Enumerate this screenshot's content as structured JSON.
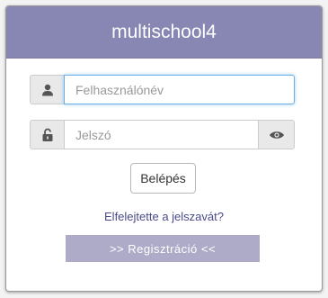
{
  "header": {
    "title": "multischool4"
  },
  "login": {
    "username_placeholder": "Felhasználónév",
    "username_value": "",
    "password_placeholder": "Jelszó",
    "password_value": "",
    "submit_label": "Belépés",
    "forgot_label": "Elfelejtette a jelszavát?",
    "register_label": ">> Regisztráció <<"
  },
  "icons": {
    "user": "user-icon",
    "lock": "unlock-icon",
    "eye": "eye-icon"
  },
  "colors": {
    "header_bg": "#8886b3",
    "register_bg": "#adabc8",
    "link": "#4a4a8a",
    "focus": "#66afe9"
  }
}
